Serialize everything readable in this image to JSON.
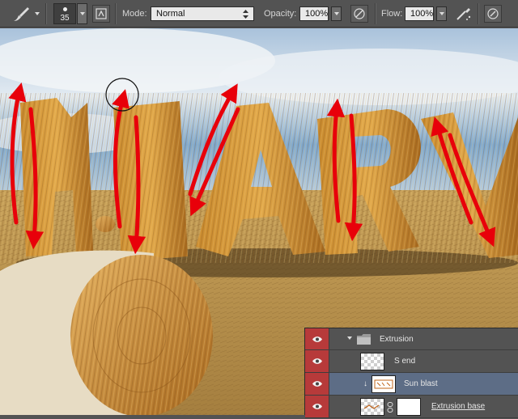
{
  "options_bar": {
    "tool": "brush-tool",
    "brush_size": "35",
    "mode_label": "Mode:",
    "mode_value": "Normal",
    "opacity_label": "Opacity:",
    "opacity_value": "100%",
    "flow_label": "Flow:",
    "flow_value": "100%"
  },
  "layers": {
    "group": {
      "name": "Extrusion"
    },
    "items": [
      {
        "name": "S end"
      },
      {
        "name": "Sun blast"
      },
      {
        "name": "Extrusion base"
      }
    ]
  },
  "colors": {
    "arrow_red": "#e8000a",
    "eye_cell_red": "#b73a3a",
    "selected_row": "#5d6d86",
    "panel_gray": "#535353"
  }
}
